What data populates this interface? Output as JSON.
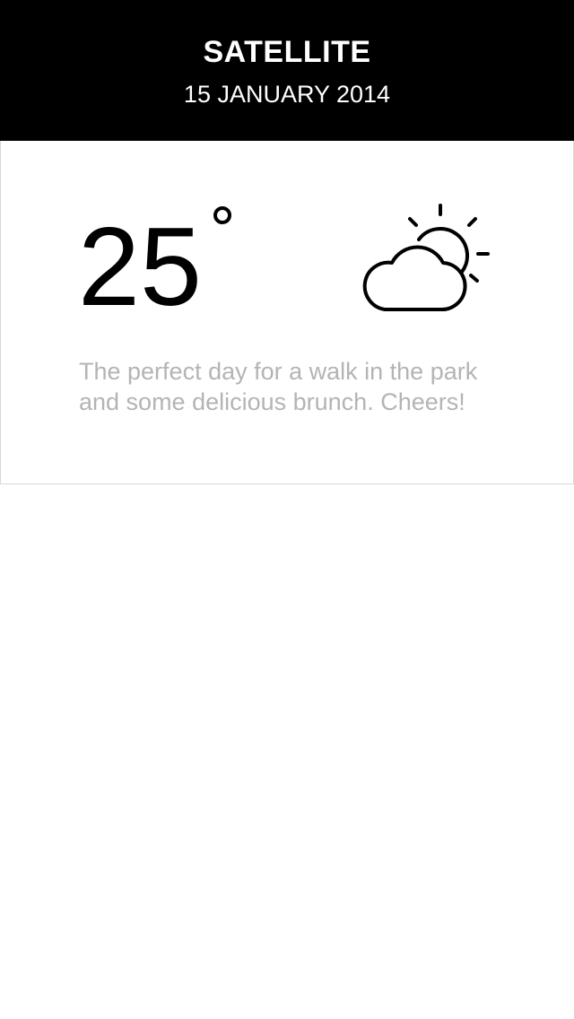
{
  "header": {
    "title": "SATELLITE",
    "date": "15 JANUARY 2014"
  },
  "weather": {
    "temperature": "25",
    "unit_symbol": "degree-icon",
    "condition_icon": "partly-cloudy-icon",
    "description_line1": "The perfect day for a walk in the park",
    "description_line2": "and some delicious brunch. Cheers!"
  },
  "colors": {
    "header_bg": "#000000",
    "header_text": "#ffffff",
    "description_text": "#b4b4b4",
    "card_border": "#d8d8d8"
  }
}
